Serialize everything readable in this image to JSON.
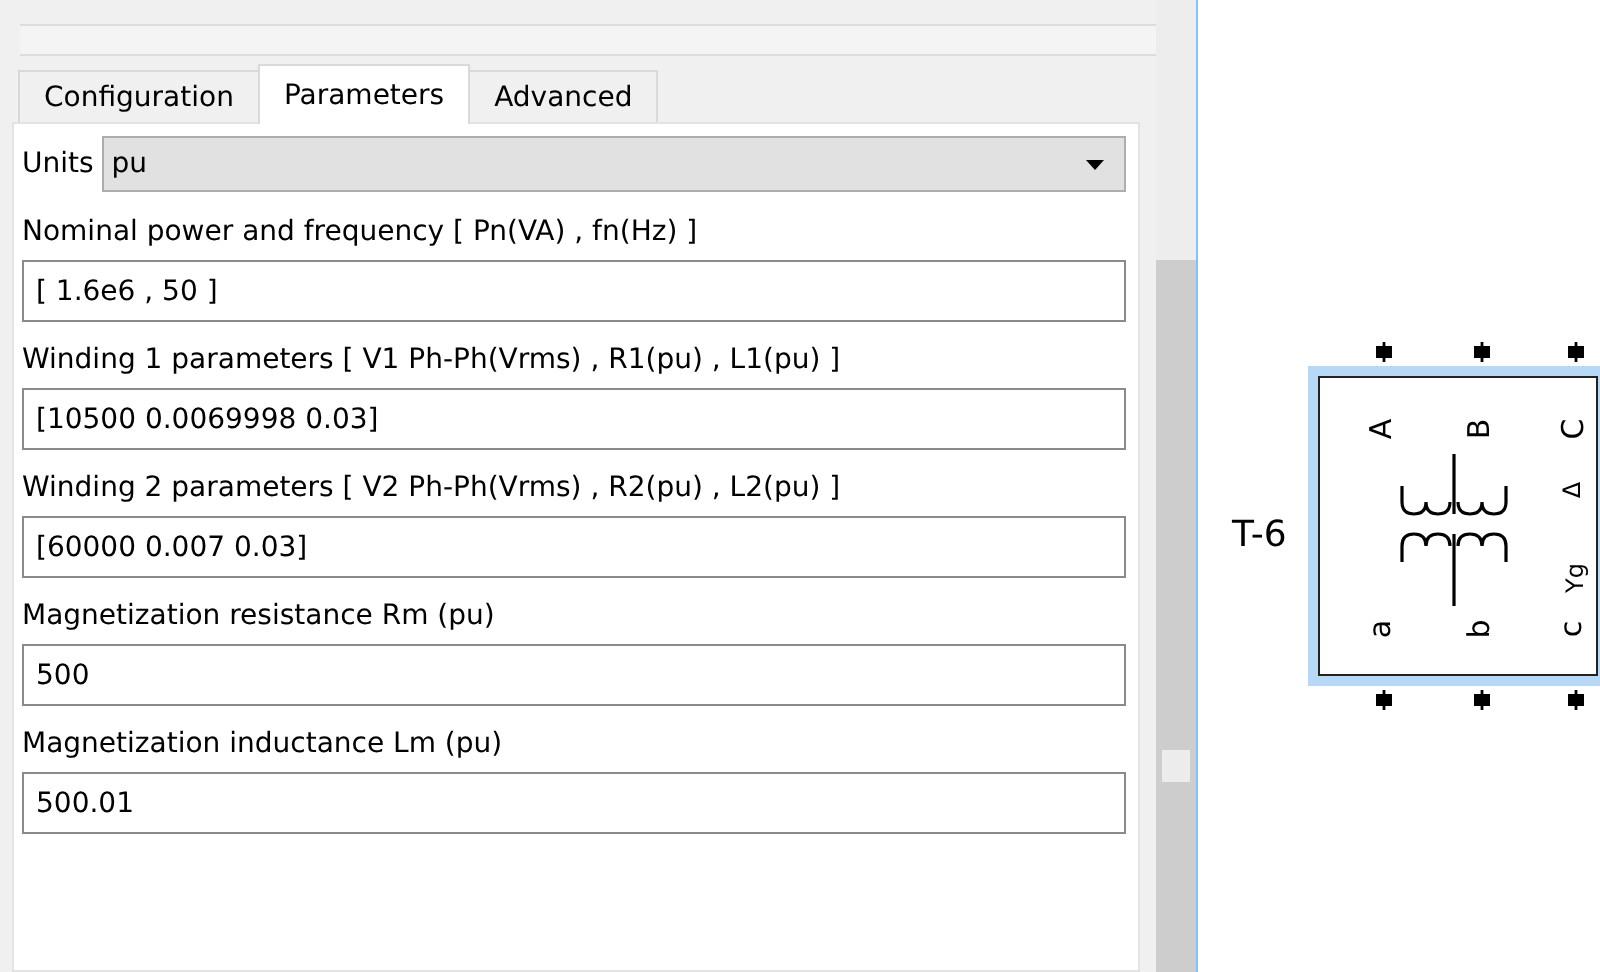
{
  "tabs": [
    {
      "label": "Configuration",
      "selected": false
    },
    {
      "label": "Parameters",
      "selected": true
    },
    {
      "label": "Advanced",
      "selected": false
    }
  ],
  "units": {
    "label": "Units",
    "value": "pu"
  },
  "parameters": [
    {
      "label": "Nominal power and frequency  [ Pn(VA) , fn(Hz) ]",
      "value": "[ 1.6e6 , 50 ]"
    },
    {
      "label": "Winding 1 parameters [ V1 Ph-Ph(Vrms) , R1(pu) , L1(pu) ]",
      "value": "[10500 0.0069998 0.03]"
    },
    {
      "label": "Winding 2 parameters [ V2 Ph-Ph(Vrms) , R2(pu) , L2(pu) ]",
      "value": "[60000 0.007 0.03]"
    },
    {
      "label": "Magnetization resistance  Rm (pu)",
      "value": "500"
    },
    {
      "label": "Magnetization inductance  Lm (pu)",
      "value": "500.01"
    }
  ],
  "block": {
    "name": "T-6",
    "selected": true,
    "top_ports": [
      "A",
      "B",
      "C"
    ],
    "bottom_ports": [
      "a",
      "b",
      "c"
    ],
    "primary_connection": "Δ",
    "secondary_connection": "Yg"
  }
}
